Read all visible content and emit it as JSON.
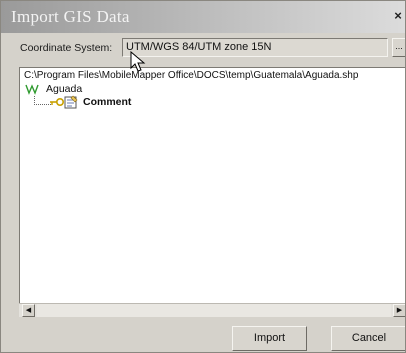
{
  "window": {
    "title": "Import GIS Data",
    "close_glyph": "×"
  },
  "coordinate_system": {
    "label": "Coordinate System:",
    "value": "UTM/WGS 84/UTM zone 15N",
    "browse_label": "..."
  },
  "tree": {
    "path": "C:\\Program Files\\MobileMapper Office\\DOCS\\temp\\Guatemala\\Aguada.shp",
    "layer": {
      "icon": "polyline-layer-icon",
      "label": "Aguada",
      "color": "#2f9a2f"
    },
    "field": {
      "icon": "key-field-icon",
      "label": "Comment",
      "key_color": "#c8a000"
    }
  },
  "scrollbar": {
    "left_glyph": "◀",
    "right_glyph": "▶"
  },
  "buttons": {
    "import_label": "Import",
    "cancel_label": "Cancel"
  }
}
